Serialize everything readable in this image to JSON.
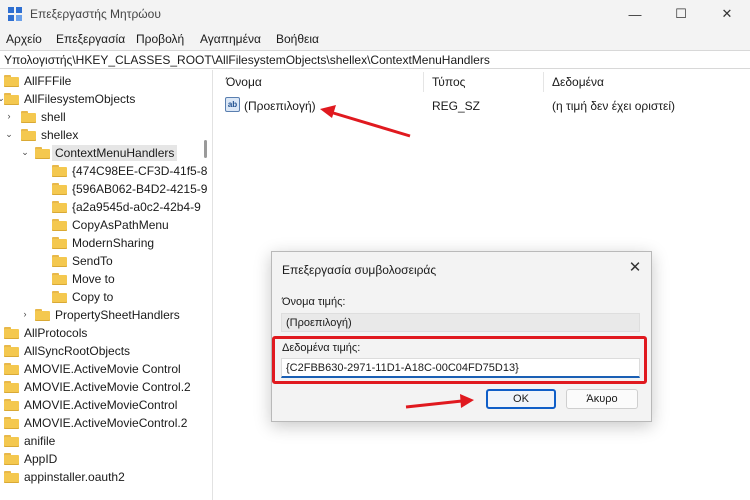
{
  "window": {
    "title": "Επεξεργαστής Μητρώου",
    "minimize_glyph": "—",
    "maximize_glyph": "☐",
    "close_glyph": "✕"
  },
  "menu": [
    "Αρχείο",
    "Επεξεργασία",
    "Προβολή",
    "Αγαπημένα",
    "Βοήθεια"
  ],
  "address": "Υπολογιστής\\HKEY_CLASSES_ROOT\\AllFilesystemObjects\\shellex\\ContextMenuHandlers",
  "tree": [
    {
      "label": "AllFFFile"
    },
    {
      "label": "AllFilesystemObjects"
    },
    {
      "label": "shell"
    },
    {
      "label": "shellex"
    },
    {
      "label": "ContextMenuHandlers"
    },
    {
      "label": "{474C98EE-CF3D-41f5-8"
    },
    {
      "label": "{596AB062-B4D2-4215-9"
    },
    {
      "label": "{a2a9545d-a0c2-42b4-9"
    },
    {
      "label": "CopyAsPathMenu"
    },
    {
      "label": "ModernSharing"
    },
    {
      "label": "SendTo"
    },
    {
      "label": "Move to"
    },
    {
      "label": "Copy to"
    },
    {
      "label": "PropertySheetHandlers"
    },
    {
      "label": "AllProtocols"
    },
    {
      "label": "AllSyncRootObjects"
    },
    {
      "label": "AMOVIE.ActiveMovie Control"
    },
    {
      "label": "AMOVIE.ActiveMovie Control.2"
    },
    {
      "label": "AMOVIE.ActiveMovieControl"
    },
    {
      "label": "AMOVIE.ActiveMovieControl.2"
    },
    {
      "label": "anifile"
    },
    {
      "label": "AppID"
    },
    {
      "label": "appinstaller.oauth2"
    }
  ],
  "list": {
    "columns": [
      "Όνομα",
      "Τύπος",
      "Δεδομένα"
    ],
    "rows": [
      {
        "icon": "string-value-icon",
        "icon_text": "ab",
        "name": "(Προεπιλογή)",
        "type": "REG_SZ",
        "data": "(η τιμή δεν έχει οριστεί)"
      }
    ]
  },
  "dialog": {
    "title": "Επεξεργασία συμβολοσειράς",
    "value_name_label": "Όνομα τιμής:",
    "value_name": "(Προεπιλογή)",
    "value_data_label": "Δεδομένα τιμής:",
    "value_data": "{C2FBB630-2971-11D1-A18C-00C04FD75D13}",
    "ok_label": "OK",
    "cancel_label": "Άκυρο",
    "close_glyph": "✕"
  },
  "colors": {
    "annotation_red": "#e0191f",
    "focus_blue": "#0f5ec8",
    "folder_yellow": "#f4c84f"
  }
}
